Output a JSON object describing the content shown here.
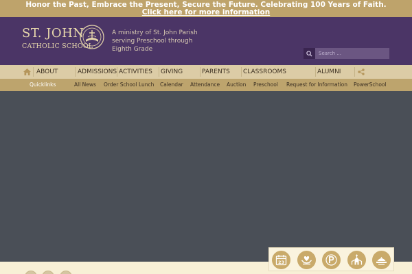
{
  "announcement": {
    "line1": "Honor the Past, Embrace the Present, Secure the Future.  Celebrating 100 Years of Faith.",
    "link": "Click here for more information"
  },
  "brand": {
    "name": "ST. JOHN",
    "sub": "CATHOLIC SCHOOL",
    "tagline": "A ministry of St. John Parish serving Preschool through Eighth Grade"
  },
  "search": {
    "placeholder": "Search ..."
  },
  "mainnav": {
    "items": [
      {
        "label": "ABOUT"
      },
      {
        "label": "ADMISSIONS"
      },
      {
        "label": "ACTIVITIES"
      },
      {
        "label": "GIVING"
      },
      {
        "label": "PARENTS"
      },
      {
        "label": "CLASSROOMS"
      },
      {
        "label": "ALUMNI"
      }
    ]
  },
  "quicklinks": {
    "label": "Quicklinks",
    "items": [
      {
        "label": "All News"
      },
      {
        "label": "Order School Lunch"
      },
      {
        "label": "Calendar"
      },
      {
        "label": "Attendance"
      },
      {
        "label": "Auction"
      },
      {
        "label": "Preschool"
      },
      {
        "label": "Request for Information"
      },
      {
        "label": "PowerSchool"
      }
    ]
  },
  "iconbar": {
    "calendar_day": "23",
    "icons": [
      "calendar-icon",
      "heart-hands-icon",
      "powerschool-icon",
      "church-icon",
      "lunch-icon"
    ]
  },
  "colors": {
    "announcement_bg": "#bea36b",
    "header_bg": "#4b3566",
    "nav_bg": "#dccca6",
    "quick_bg": "#bda46d",
    "hero_bg": "#4a4f57",
    "gold": "#c9aa6a"
  }
}
